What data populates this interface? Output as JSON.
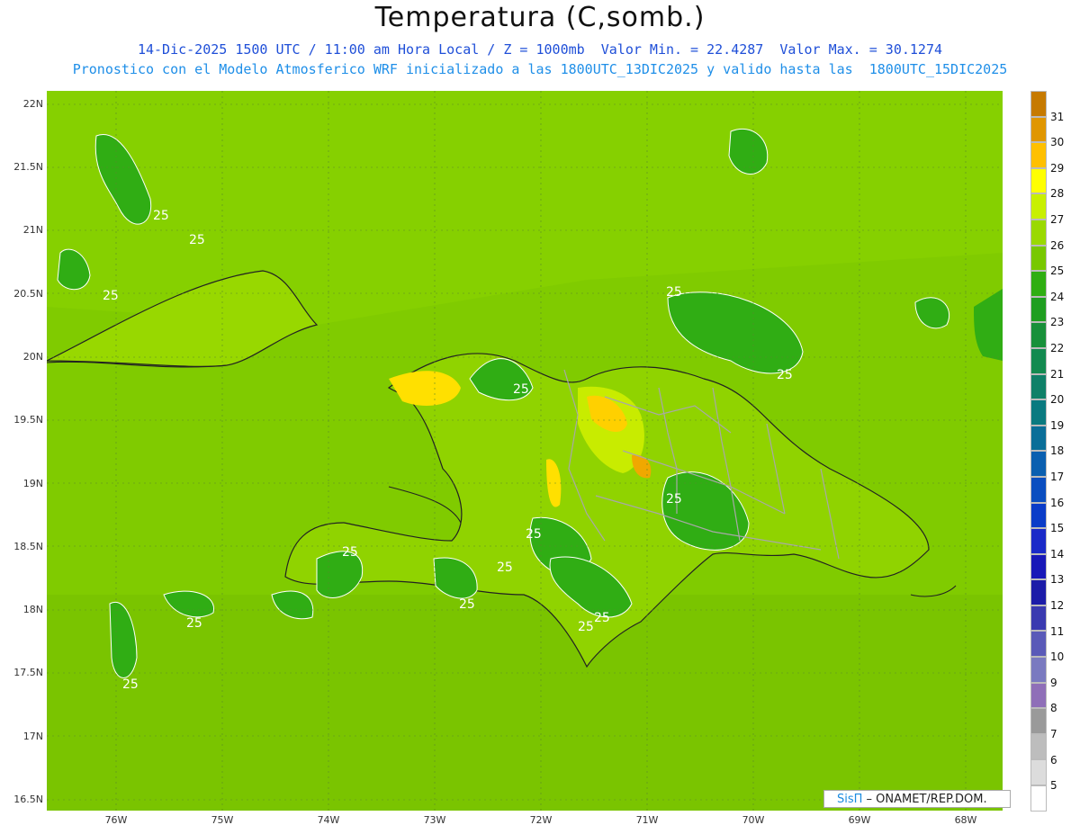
{
  "title": "Temperatura (C,somb.)",
  "subtitle_line1": "14-Dic-2025 1500 UTC / 11:00 am Hora Local / Z = 1000mb  Valor Min. = 22.4287  Valor Max. = 30.1274",
  "subtitle_line2": "Pronostico con el Modelo Atmosferico WRF inicializado a las 1800UTC_13DIC2025 y valido hasta las  1800UTC_15DIC2025",
  "credit": {
    "brand": "SisΠ",
    "text": " – ONAMET/REP.DOM."
  },
  "lat_labels": [
    "22N",
    "21.5N",
    "21N",
    "20.5N",
    "20N",
    "19.5N",
    "19N",
    "18.5N",
    "18N",
    "17.5N",
    "17N",
    "16.5N"
  ],
  "lon_labels": [
    "76W",
    "75W",
    "74W",
    "73W",
    "72W",
    "71W",
    "70W",
    "69W",
    "68W"
  ],
  "contour_labels": [
    "25",
    "25",
    "25",
    "25",
    "25",
    "25",
    "25",
    "25",
    "25",
    "25",
    "25",
    "25",
    "25",
    "25",
    "25"
  ],
  "colorbar": {
    "labels": [
      "31",
      "30",
      "29",
      "28",
      "27",
      "26",
      "25",
      "24",
      "23",
      "22",
      "21",
      "20",
      "19",
      "18",
      "17",
      "16",
      "15",
      "14",
      "13",
      "12",
      "11",
      "10",
      "9",
      "8",
      "7",
      "6",
      "5"
    ],
    "colors": [
      "#c67a00",
      "#e09600",
      "#ffc000",
      "#ffff00",
      "#c8f000",
      "#9ad900",
      "#78c800",
      "#2fae12",
      "#1f9e20",
      "#18903a",
      "#138a50",
      "#0f8068",
      "#0a7a80",
      "#0a6e98",
      "#0a5fb0",
      "#0a4ec0",
      "#0a3cc8",
      "#1a2ac8",
      "#1818b8",
      "#1c1ca8",
      "#3a3ab0",
      "#5a5ab8",
      "#7a7ac0",
      "#8f6fb8",
      "#9a9a9a",
      "#bdbdbd",
      "#dcdcdc",
      "#ffffff"
    ],
    "colors_note": ""
  },
  "palette": {
    "sea": "#7fc800",
    "land_warm": "#a8e000",
    "land_hot": "#ffe000",
    "cool": "#2fae12"
  }
}
